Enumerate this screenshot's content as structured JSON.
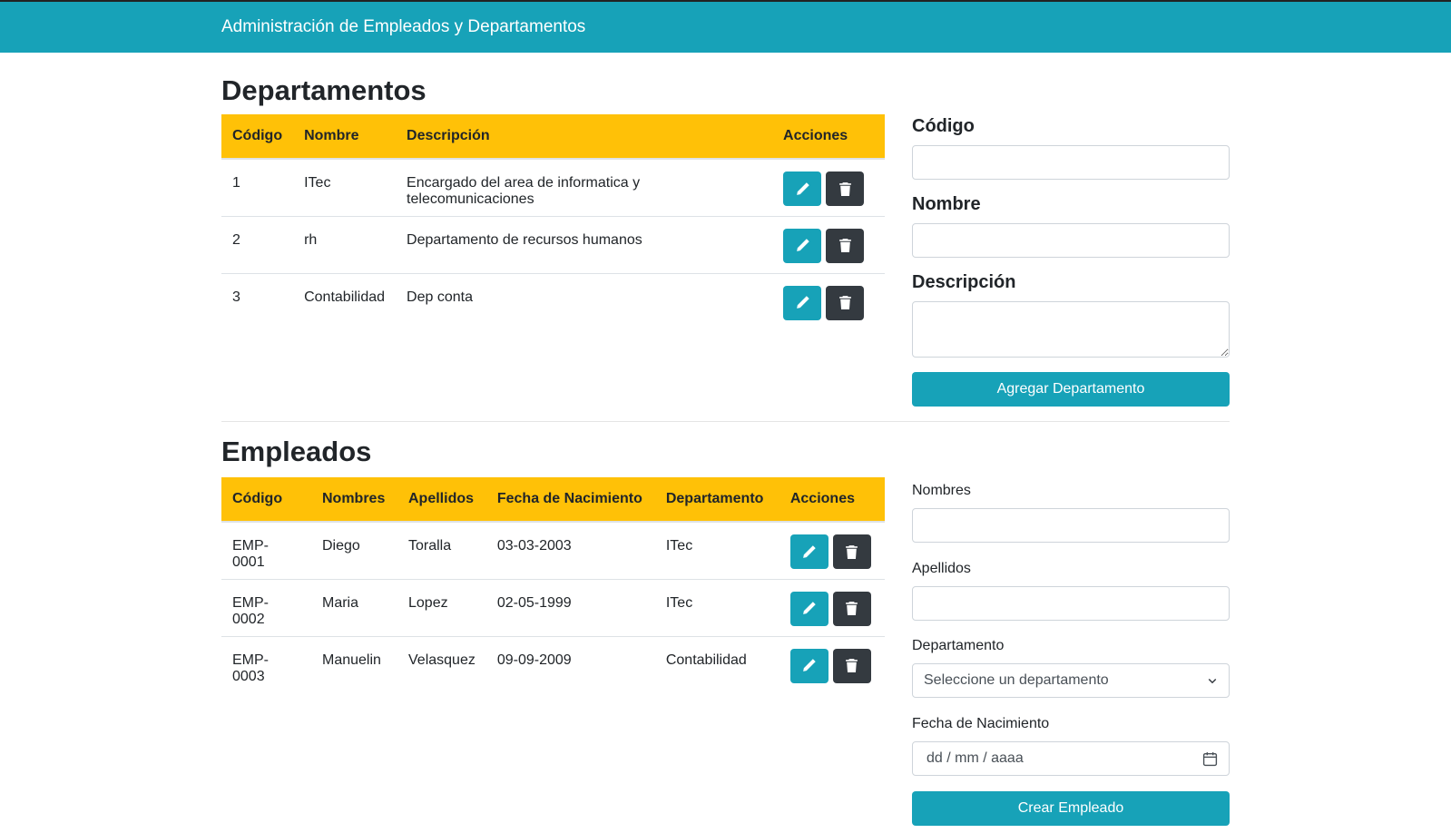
{
  "header": {
    "title": "Administración de Empleados y Departamentos"
  },
  "departments": {
    "title": "Departamentos",
    "columns": [
      "Código",
      "Nombre",
      "Descripción",
      "Acciones"
    ],
    "rows": [
      {
        "code": "1",
        "name": "ITec",
        "description": "Encargado del area de informatica y telecomunicaciones"
      },
      {
        "code": "2",
        "name": "rh",
        "description": "Departamento de recursos humanos"
      },
      {
        "code": "3",
        "name": "Contabilidad",
        "description": "Dep conta"
      }
    ],
    "form": {
      "code_label": "Código",
      "name_label": "Nombre",
      "description_label": "Descripción",
      "code_value": "",
      "name_value": "",
      "description_value": "",
      "submit_label": "Agregar Departamento"
    }
  },
  "employees": {
    "title": "Empleados",
    "columns": [
      "Código",
      "Nombres",
      "Apellidos",
      "Fecha de Nacimiento",
      "Departamento",
      "Acciones"
    ],
    "rows": [
      {
        "code": "EMP-0001",
        "first_name": "Diego",
        "last_name": "Toralla",
        "birth_date": "03-03-2003",
        "department": "ITec"
      },
      {
        "code": "EMP-0002",
        "first_name": "Maria",
        "last_name": "Lopez",
        "birth_date": "02-05-1999",
        "department": "ITec"
      },
      {
        "code": "EMP-0003",
        "first_name": "Manuelin",
        "last_name": "Velasquez",
        "birth_date": "09-09-2009",
        "department": "Contabilidad"
      }
    ],
    "form": {
      "first_name_label": "Nombres",
      "last_name_label": "Apellidos",
      "department_label": "Departamento",
      "department_selected": "Seleccione un departamento",
      "birth_date_label": "Fecha de Nacimiento",
      "birth_date_placeholder": "dd / mm / aaaa",
      "first_name_value": "",
      "last_name_value": "",
      "submit_label": "Crear Empleado"
    }
  },
  "icons": {
    "edit": "pencil-icon",
    "delete": "trash-icon",
    "select": "chevron-down-icon",
    "date": "calendar-icon"
  },
  "colors": {
    "primary": "#17a2b8",
    "table_header": "#ffc107",
    "dark": "#343a40"
  }
}
